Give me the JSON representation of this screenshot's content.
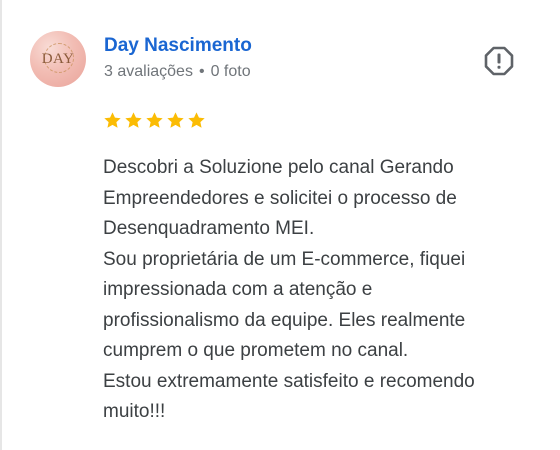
{
  "reviewer": {
    "name": "Day Nascimento",
    "avatar_text": "Day",
    "reviews_count": "3 avaliações",
    "separator": "•",
    "photos_count": "0 foto"
  },
  "report": {
    "icon": "report-flag-icon"
  },
  "rating": {
    "stars": 5,
    "max": 5,
    "color": "#fbbc04"
  },
  "review": {
    "lines": [
      "Descobri a Soluzione pelo canal Gerando",
      "Empreendedores e solicitei o processo de",
      "Desenquadramento MEI.",
      "Sou proprietária de um E-commerce, fiquei",
      "impressionada com a atenção e",
      "profissionalismo da equipe. Eles realmente",
      "cumprem o que prometem no canal.",
      "Estou extremamente satisfeito e recomendo",
      "muito!!!"
    ]
  },
  "colors": {
    "name": "#1a66d2",
    "meta": "#70757a",
    "text": "#3c4043",
    "icon": "#5f6368"
  }
}
